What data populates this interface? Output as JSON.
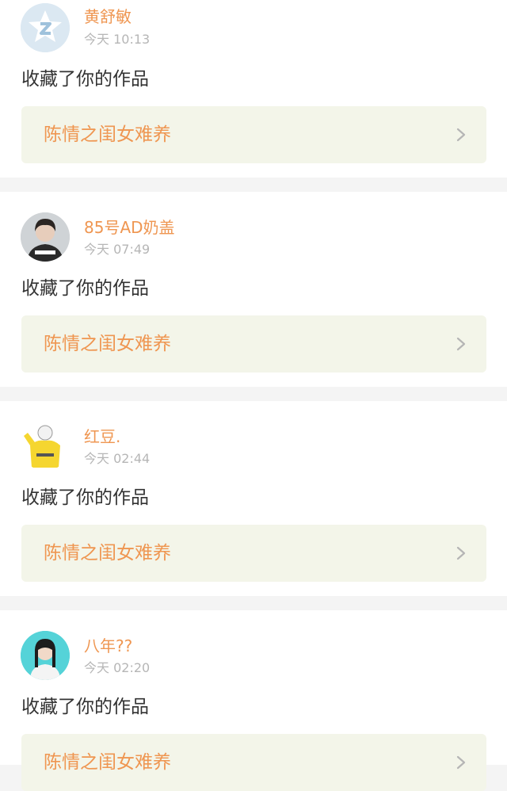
{
  "notifications": [
    {
      "user_name": "黄舒敏",
      "time": "今天 10:13",
      "action": "收藏了你的作品",
      "work_title": "陈情之闺女难养",
      "avatar": "default-avatar-icon"
    },
    {
      "user_name": "85号AD奶盖",
      "time": "今天 07:49",
      "action": "收藏了你的作品",
      "work_title": "陈情之闺女难养",
      "avatar": "photo-avatar"
    },
    {
      "user_name": "红豆.",
      "time": "今天 02:44",
      "action": "收藏了你的作品",
      "work_title": "陈情之闺女难养",
      "avatar": "cartoon-avatar"
    },
    {
      "user_name": "八年??",
      "time": "今天 02:20",
      "action": "收藏了你的作品",
      "work_title": "陈情之闺女难养",
      "avatar": "photo-avatar"
    }
  ],
  "colors": {
    "accent": "#ef9651",
    "work_background": "#f3f5e9",
    "separator": "#f4f4f4"
  }
}
